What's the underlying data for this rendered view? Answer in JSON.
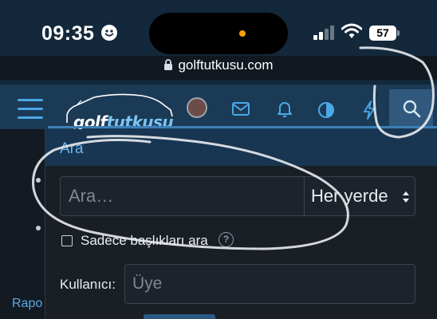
{
  "status_bar": {
    "time": "09:35",
    "battery": "57",
    "focus_icon": "smiley-face-icon",
    "signal_bars_active": 2,
    "signal_bars_total": 4
  },
  "browser": {
    "url": "golftutkusu.com",
    "lock_icon": "lock-icon"
  },
  "header": {
    "logo_text_a": "golf",
    "logo_text_b": "tutkusu",
    "icons": [
      "menu-icon",
      "avatar",
      "mail-icon",
      "bell-icon",
      "theme-icon",
      "lightning-icon",
      "search-icon"
    ]
  },
  "search": {
    "title": "Ara",
    "query_placeholder": "Ara…",
    "scope_value": "Her yerde",
    "titles_only_label": "Sadece başlıkları ara",
    "user_label": "Kullanıcı:",
    "user_placeholder": "Üye"
  },
  "background_page": {
    "link_text": "Rapo"
  },
  "colors": {
    "accent": "#4aa8e8",
    "header_bg": "#1b3a56",
    "panel_bg": "#1a1f26",
    "search_button_bg": "#30597d"
  }
}
